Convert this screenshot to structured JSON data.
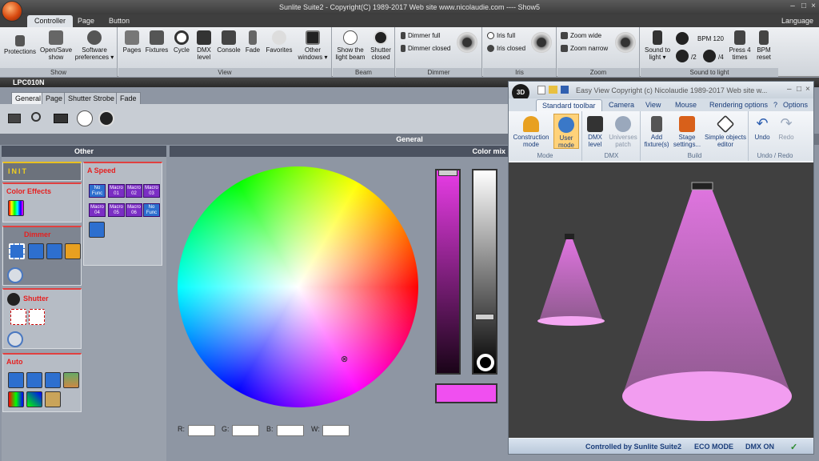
{
  "app": {
    "title": "Sunlite Suite2 - Copyright(C) 1989-2017     Web site www.nicolaudie.com ---- Show5",
    "language": "Language"
  },
  "tabs": [
    "Controller",
    "Page",
    "Button"
  ],
  "ribbon": {
    "show": {
      "label": "Show",
      "protections": "Protections",
      "open_save": "Open/Save show",
      "software_prefs": "Software preferences"
    },
    "view": {
      "label": "View",
      "pages": "Pages",
      "fixtures": "Fixtures",
      "cycle": "Cycle",
      "dmx_level": "DMX level",
      "console": "Console",
      "fade": "Fade",
      "favorites": "Favorites",
      "other_windows": "Other windows"
    },
    "beam": {
      "label": "Beam",
      "show_beam": "Show the light beam",
      "shutter_closed": "Shutter closed"
    },
    "dimmer": {
      "label": "Dimmer",
      "full": "Dimmer full",
      "closed": "Dimmer closed"
    },
    "iris": {
      "label": "Iris",
      "full": "Iris full",
      "closed": "Iris closed"
    },
    "zoom": {
      "label": "Zoom",
      "wide": "Zoom wide",
      "narrow": "Zoom narrow"
    },
    "sound": {
      "label": "Sound to light",
      "sound_to_light": "Sound to light",
      "bpm": "BPM 120",
      "div2": "/2",
      "div4": "/4",
      "press4": "Press 4 times",
      "bpm_reset": "BPM reset"
    }
  },
  "fixture": {
    "name": "LPC010N"
  },
  "subtabs": [
    "General",
    "Page",
    "Shutter Strobe",
    "Fade"
  ],
  "sections": {
    "general": "General",
    "other": "Other",
    "color_mix": "Color mix"
  },
  "panels": {
    "init": "INIT",
    "color_effects": "Color Effects",
    "speed": "A Speed",
    "dimmer": "Dimmer",
    "shutter": "Shutter",
    "auto": "Auto"
  },
  "macros": [
    "No Func",
    "Macro 01",
    "Macro 02",
    "Macro 03",
    "Macro 04",
    "Macro 05",
    "Macro 06",
    "No Func"
  ],
  "colors": {
    "selected": "#f04ff0",
    "dimmer_fill": "#e83ce6"
  },
  "rgbw": {
    "r": "R:",
    "g": "G:",
    "b": "B:",
    "w": "W:"
  },
  "easyview": {
    "title": "Easy View   Copyright (c) Nicolaudie 1989-2017   Web site w...",
    "options": "Options",
    "tabs": [
      "Standard toolbar",
      "Camera",
      "View",
      "Mouse",
      "Rendering options"
    ],
    "mode": {
      "label": "Mode",
      "construction": "Construction mode",
      "user": "User mode"
    },
    "dmx": {
      "label": "DMX",
      "level": "DMX level",
      "universes": "Universes patch"
    },
    "build": {
      "label": "Build",
      "add": "Add fixture(s)",
      "stage": "Stage settings...",
      "simple": "Simple objects editor"
    },
    "undo": {
      "label": "Undo / Redo",
      "undo": "Undo",
      "redo": "Redo"
    },
    "status": {
      "controlled": "Controlled by Sunlite Suite2",
      "eco": "ECO MODE",
      "dmx": "DMX ON"
    }
  }
}
